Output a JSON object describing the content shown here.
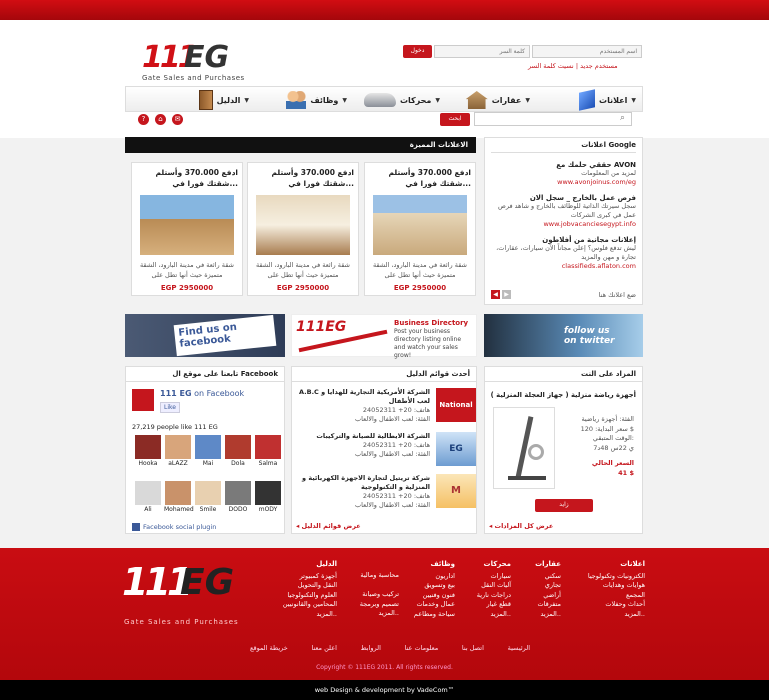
{
  "header": {
    "username_placeholder": "اسم المستخدم",
    "password_placeholder": "كلمة السر",
    "login_label": "دخول",
    "register_label": "مستخدم جديد",
    "forgot_label": "نسيت كلمة السر",
    "logo_number": "111",
    "logo_text": "EG",
    "logo_tagline": "Gate Sales and Purchases"
  },
  "nav": [
    {
      "label": "اعلانات",
      "icon": "book-icon"
    },
    {
      "label": "عقارات",
      "icon": "house-icon"
    },
    {
      "label": "محركات",
      "icon": "car-icon"
    },
    {
      "label": "وظائف",
      "icon": "people-icon"
    },
    {
      "label": "الدليل",
      "icon": "door-icon"
    }
  ],
  "search": {
    "button_label": "ابحث"
  },
  "featured": {
    "title": "الاعلانات المميزة",
    "cards": [
      {
        "title": "ادفع 370.000 وأستلم شقتك فورا في...",
        "desc": "شقة رائعة في مدينة البارود، الشقة متميزة حيث أنها تطل على",
        "price": "EGP 2950000"
      },
      {
        "title": "ادفع 370.000 وأستلم شقتك فورا في...",
        "desc": "شقة رائعة في مدينة البارود، الشقة متميزة حيث أنها تطل على",
        "price": "EGP 2950000"
      },
      {
        "title": "ادفع 370.000 وأستلم شقتك فورا في...",
        "desc": "شقة رائعة في مدينة البارود، الشقة متميزة حيث أنها تطل على",
        "price": "EGP 2950000"
      }
    ]
  },
  "google_ads": {
    "title": "اعلانات Google",
    "items": [
      {
        "head": "حققي حلمك مع AVON",
        "desc": "لمزيد من المعلومات",
        "url": "www.avonjoinus.com/eg"
      },
      {
        "head": "فرص عمل بالخارج _ سجل الان",
        "desc": "سجل سيرتك الذاتية للوظائف بالخارج و شاهد فرص عمل في كبرى الشركات",
        "url": "www.jobvacanciesegypt.info"
      },
      {
        "head": "إعلانات مجانية من أفلاطون",
        "desc": "ليش تدفع فلوس؟ إعلن مجاناً الآن سيارات، عقارات، تجارة و مهن والمزيد",
        "url": "classifieds.aflaton.com"
      }
    ],
    "footer_text": "ضع اعلانك هنا"
  },
  "banners": {
    "directory_title": "Business Directory",
    "directory_text": "Post your business directory listing online and watch your sales grow!",
    "facebook_text": "Find us on facebook",
    "twitter_text": "follow us on twitter"
  },
  "auction": {
    "title": "المزاد على النت",
    "item_title": "أجهزة رياضة منزلية ( جهاز العجلة المنزلية )",
    "details": [
      "الفئة: أجهزة رياضية",
      "سعر البداية: 120 $",
      "الوقت المتبقي:",
      "7ي 22س 48د"
    ],
    "price_label": "السعر الحالي",
    "price": "41 $",
    "bid_label": "زايد",
    "more_label": "عرض كل المزادات"
  },
  "directory": {
    "title": "أحدث قوائم الدليل",
    "items": [
      {
        "name": "A.B.C الشركة الأمريكية التجارية للهدايا و لعب الأطفال",
        "phone": "هاتف: 20+ 24052311",
        "category": "الفئة: لعب الاطفال والالعاب",
        "logo": "National"
      },
      {
        "name": "الشركة الايطالية للصيانة والتركيبات",
        "phone": "هاتف: 20+ 24052311",
        "category": "الفئة: لعب الاطفال والالعاب",
        "logo": "EG"
      },
      {
        "name": "شركة تريتيل لتجارة الاجهزة الكهربائية و المنزلية و التكنولوجية",
        "phone": "هاتف: 20+ 24052311",
        "category": "الفئة: لعب الاطفال والالعاب",
        "logo": "M"
      }
    ],
    "more_label": "عرض قوائم الدليل"
  },
  "facebook": {
    "title": "تابعنا على موقع ال Facebook",
    "page_name": "111 EG",
    "on_facebook": "on Facebook",
    "like_label": "Like",
    "count_text": "27,219 people like 111 EG",
    "faces": [
      "Hooka",
      "aLAZZ",
      "Mai",
      "Dola",
      "Salma",
      "Ali",
      "Mohamed",
      "Smile",
      "DODO",
      "mODY"
    ],
    "plugin_label": "Facebook social plugin"
  },
  "footer": {
    "columns": [
      {
        "title": "اعلانات",
        "items": [
          "الكترونيات وتكنولوجيا",
          "هوايات وهدايات",
          "المجمع",
          "أحداث وحفلات",
          "المزيد.."
        ]
      },
      {
        "title": "عقارات",
        "items": [
          "سكني",
          "تجاري",
          "أراضي",
          "متفرقات",
          "المزيد.."
        ]
      },
      {
        "title": "محركات",
        "items": [
          "سيارات",
          "آليات النقل",
          "دراجات نارية",
          "قطع غيار",
          "المزيد.."
        ]
      },
      {
        "title": "وظائف",
        "items": [
          "اداريون",
          "بيع وتسويق",
          "فنون وفنيين",
          "عمال وخدمات",
          "سياحة ومطاعم"
        ]
      },
      {
        "title": "",
        "items": [
          "محاسبة ومالية",
          "",
          "تركيب وصيانة",
          "تصميم وبرمجة",
          "المزيد.."
        ]
      },
      {
        "title": "الدليل",
        "items": [
          "أجهزة كمبيوتر",
          "النقل والتحويل",
          "العلوم والتكنولوجيا",
          "المحامين والقانونيين",
          "المزيد.."
        ]
      }
    ],
    "links": [
      "الرئيسية",
      "اتصل بنا",
      "معلومات عنا",
      "الروابط",
      "اعلن معنا",
      "خريطة الموقع"
    ],
    "copyright": "Copyright © 111EG 2011. All rights reserved.",
    "credit": "web Design & development by VadeCom™"
  }
}
